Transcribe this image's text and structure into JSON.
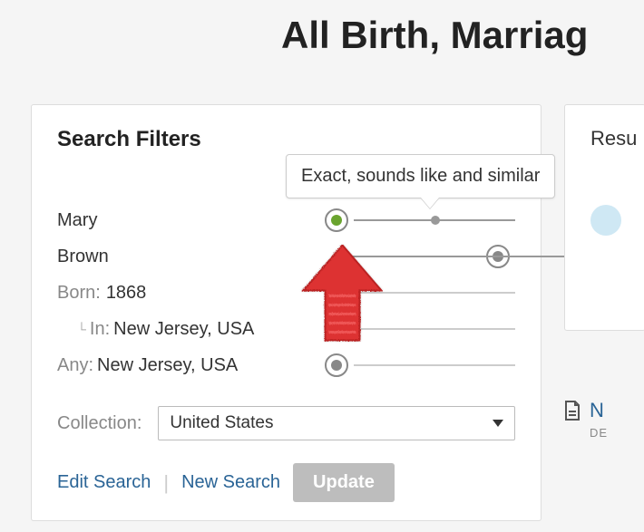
{
  "page": {
    "title": "All Birth, Marriag"
  },
  "filters": {
    "heading": "Search Filters",
    "tooltip": "Exact, sounds like and similar",
    "rows": {
      "first_name": "Mary",
      "last_name": "Brown",
      "born_label": "Born:",
      "born_year": "1868",
      "in_marker": "└ In:",
      "in_place": "New Jersey, USA",
      "any_label": "Any:",
      "any_place": "New Jersey, USA"
    },
    "collection": {
      "label": "Collection:",
      "selected": "United States"
    },
    "links": {
      "edit": "Edit Search",
      "new": "New Search"
    },
    "update": "Update"
  },
  "results": {
    "heading": "Resu",
    "link_initial": "N",
    "de": "DE"
  }
}
